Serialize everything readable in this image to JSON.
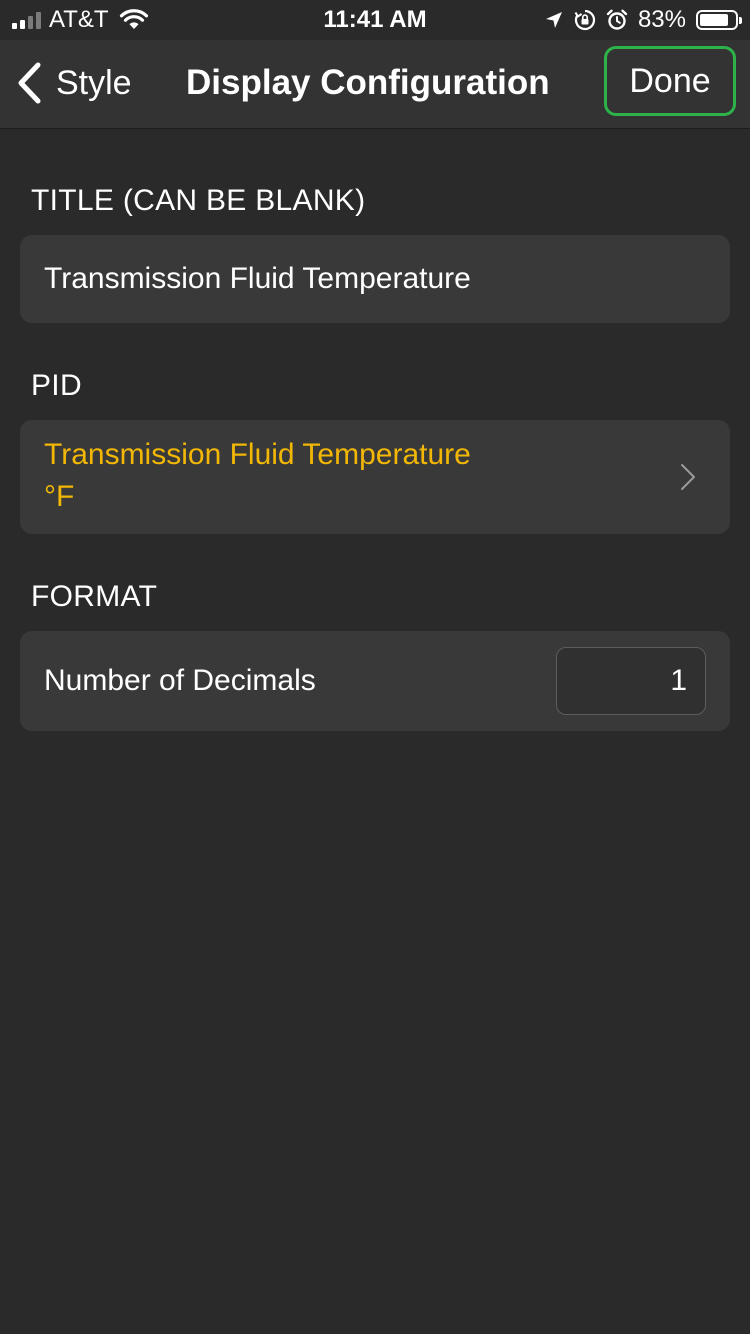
{
  "status_bar": {
    "carrier": "AT&T",
    "time": "11:41 AM",
    "battery_percent": "83%",
    "battery_level": 0.83,
    "signal_bars": 2,
    "icons": [
      "signal-icon",
      "wifi-icon",
      "location-icon",
      "rotation-lock-icon",
      "alarm-icon",
      "battery-icon"
    ]
  },
  "nav": {
    "back_label": "Style",
    "title": "Display Configuration",
    "done_label": "Done",
    "back_icon": "chevron-left-icon",
    "done_highlight_color": "#2eb34a"
  },
  "sections": {
    "title": {
      "header": "TITLE (CAN BE BLANK)",
      "value": "Transmission Fluid Temperature"
    },
    "pid": {
      "header": "PID",
      "name": "Transmission Fluid Temperature",
      "unit": "°F",
      "accent_color": "#f2b705",
      "icon": "chevron-right-icon"
    },
    "format": {
      "header": "FORMAT",
      "decimals_label": "Number of Decimals",
      "decimals_value": "1"
    }
  }
}
